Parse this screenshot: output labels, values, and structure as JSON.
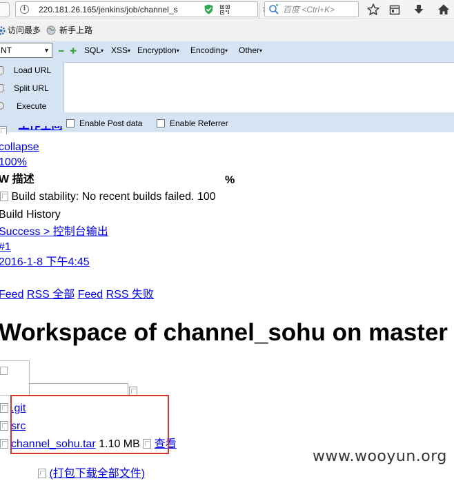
{
  "browser": {
    "url": "220.181.26.165/jenkins/job/channel_s",
    "search_placeholder": "百度 <Ctrl+K>",
    "reload_glyph": "↻",
    "bookmarks": [
      "访问最多",
      "新手上路"
    ]
  },
  "hackbar": {
    "select_value": "NT",
    "menus": [
      "SQL",
      "XSS",
      "Encryption",
      "Encoding",
      "Other"
    ],
    "actions": [
      "Load URL",
      "Split URL",
      "Execute"
    ],
    "checkboxes": [
      "Enable Post data",
      "Enable Referrer"
    ]
  },
  "page": {
    "top_link_partial": "工作空间",
    "collapse": "collapse",
    "zoom": "100%",
    "health_header_w": "W",
    "health_header_desc": "描述",
    "health_header_pct": "%",
    "health_row_text": "Build stability: No recent builds failed.",
    "health_row_pct": "100",
    "build_history": "Build History",
    "build_status": "Success > 控制台输出",
    "build_number": "#1",
    "build_date": "2016-1-8 下午4:45",
    "feed_all": "Feed",
    "rss_all": "RSS 全部",
    "feed_fail": "Feed",
    "rss_fail": "RSS 失败",
    "workspace_title": "Workspace of channel_sohu on master",
    "files": [
      {
        "name": ".git"
      },
      {
        "name": "src"
      },
      {
        "name": "channel_sohu.tar",
        "size": "1.10 MB",
        "action": "查看"
      }
    ],
    "download_all": "(打包下载全部文件)"
  },
  "watermark": "www.wooyun.org",
  "colors": {
    "link": "#0000ee",
    "hackbar_bg": "#d5e3f3",
    "highlight": "#e03131"
  }
}
